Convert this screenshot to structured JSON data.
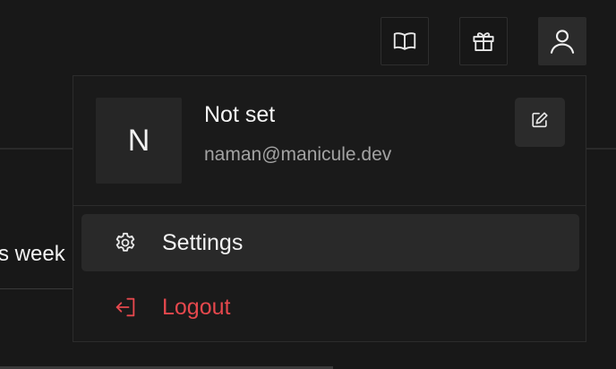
{
  "background": {
    "partial_text": "s week"
  },
  "toolbar": {
    "docs_icon": "book-open-icon",
    "gift_icon": "gift-icon",
    "user_icon": "user-icon"
  },
  "profile": {
    "avatar_initial": "N",
    "name": "Not set",
    "email": "naman@manicule.dev",
    "edit_icon": "edit-icon"
  },
  "menu": {
    "items": [
      {
        "label": "Settings",
        "icon": "gear-icon"
      },
      {
        "label": "Logout",
        "icon": "logout-icon"
      }
    ]
  },
  "colors": {
    "background": "#181818",
    "panel": "#1a1a1a",
    "hover": "#292929",
    "danger": "#e5484d",
    "text": "#f2f2f2",
    "muted": "#a3a3a3"
  }
}
